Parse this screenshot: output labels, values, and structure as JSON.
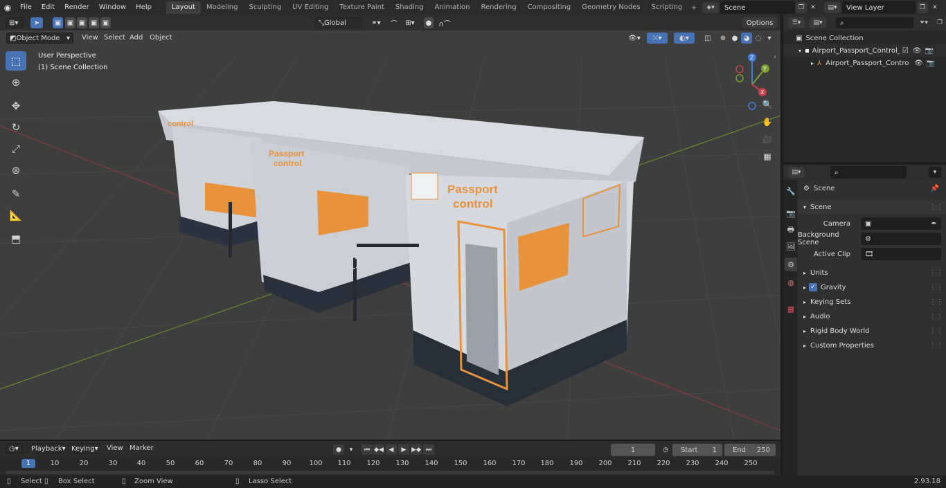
{
  "topbar": {
    "menu": [
      "File",
      "Edit",
      "Render",
      "Window",
      "Help"
    ],
    "workspaces": [
      "Layout",
      "Modeling",
      "Sculpting",
      "UV Editing",
      "Texture Paint",
      "Shading",
      "Animation",
      "Rendering",
      "Compositing",
      "Geometry Nodes",
      "Scripting"
    ],
    "active_workspace": "Layout",
    "scene_name": "Scene",
    "view_layer": "View Layer"
  },
  "viewport": {
    "mode": "Object Mode",
    "menu": [
      "View",
      "Select",
      "Add",
      "Object"
    ],
    "transform_orientation": "Global",
    "options_label": "Options",
    "overlay_title": "User Perspective",
    "overlay_collection": "(1) Scene Collection",
    "sign_text_1": "Passport",
    "sign_text_2": "control",
    "axis_x": "X",
    "axis_y": "Y",
    "axis_z": "Z"
  },
  "outliner": {
    "root": "Scene Collection",
    "collection": "Airport_Passport_Control_Co",
    "object": "Airport_Passport_Control"
  },
  "properties": {
    "context": "Scene",
    "panel": "Scene",
    "camera_label": "Camera",
    "background_scene_label": "Background Scene",
    "active_clip_label": "Active Clip",
    "subpanels": [
      "Units",
      "Gravity",
      "Keying Sets",
      "Audio",
      "Rigid Body World",
      "Custom Properties"
    ]
  },
  "timeline": {
    "menu": [
      "Playback",
      "Keying",
      "View",
      "Marker"
    ],
    "current_frame": "1",
    "start_label": "Start",
    "start": "1",
    "end_label": "End",
    "end": "250",
    "ticks": [
      "1",
      "10",
      "20",
      "30",
      "40",
      "50",
      "60",
      "70",
      "80",
      "90",
      "100",
      "110",
      "120",
      "130",
      "140",
      "150",
      "160",
      "170",
      "180",
      "190",
      "200",
      "210",
      "220",
      "230",
      "240",
      "250"
    ]
  },
  "status": {
    "select": "Select",
    "box_select": "Box Select",
    "zoom_view": "Zoom View",
    "lasso_select": "Lasso Select",
    "version": "2.93.18"
  },
  "colors": {
    "accent": "#4772b3",
    "orange": "#ef9a3c",
    "viewport_bg": "#3e3e3e"
  }
}
